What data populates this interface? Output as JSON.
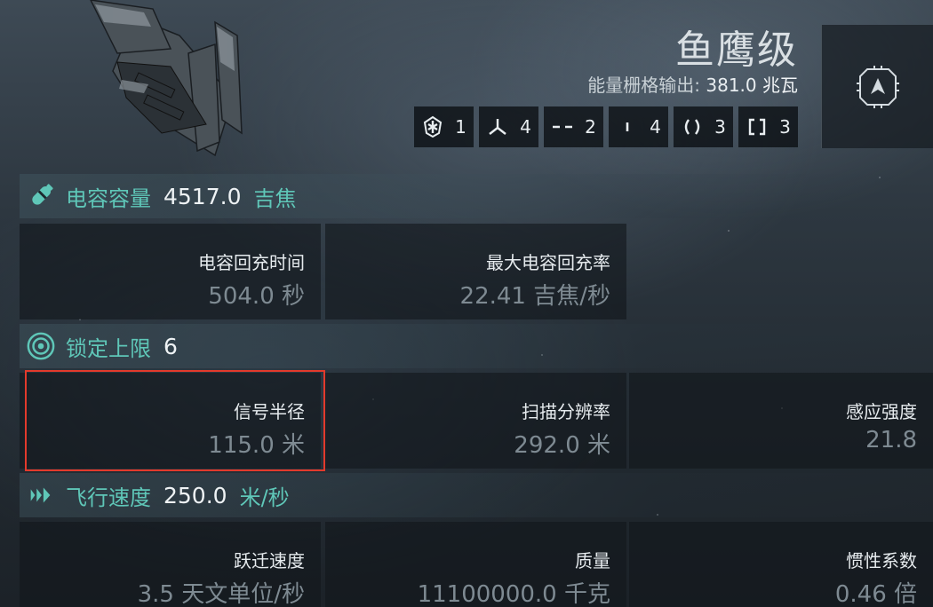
{
  "ship": {
    "name": "鱼鹰级",
    "powergrid_label": "能量栅格输出:",
    "powergrid_value": "381.0",
    "powergrid_unit": "兆瓦"
  },
  "slots": [
    {
      "icon": "drone-bay-icon",
      "count": "1"
    },
    {
      "icon": "turret-hardpoint-icon",
      "count": "4"
    },
    {
      "icon": "low-slot-icon",
      "count": "2"
    },
    {
      "icon": "high-slot-icon",
      "count": "4"
    },
    {
      "icon": "med-slot-icon",
      "count": "3"
    },
    {
      "icon": "rig-slot-icon",
      "count": "3"
    }
  ],
  "capacitor": {
    "label": "电容容量",
    "value": "4517.0",
    "unit": "吉焦",
    "stats": [
      {
        "label": "电容回充时间",
        "value": "504.0 秒"
      },
      {
        "label": "最大电容回充率",
        "value": "22.41 吉焦/秒"
      }
    ]
  },
  "targeting": {
    "label": "锁定上限",
    "value": "6",
    "stats": [
      {
        "label": "信号半径",
        "value": "115.0 米"
      },
      {
        "label": "扫描分辨率",
        "value": "292.0 米"
      },
      {
        "label": "感应强度",
        "value": "21.8"
      }
    ]
  },
  "navigation": {
    "label": "飞行速度",
    "value": "250.0",
    "unit": "米/秒",
    "stats": [
      {
        "label": "跃迁速度",
        "value": "3.5 天文单位/秒"
      },
      {
        "label": "质量",
        "value": "11100000.0 千克"
      },
      {
        "label": "惯性系数",
        "value": "0.46 倍"
      }
    ]
  },
  "colors": {
    "accent": "#5fc7b8",
    "highlight": "#e33a2c"
  }
}
